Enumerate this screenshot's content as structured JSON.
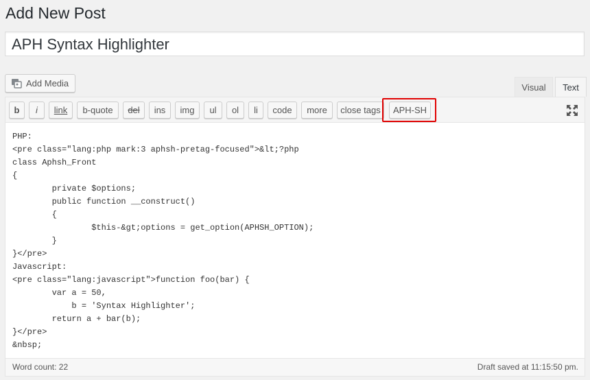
{
  "page": {
    "title": "Add New Post"
  },
  "post": {
    "title_value": "APH Syntax Highlighter"
  },
  "media": {
    "add_label": "Add Media"
  },
  "tabs": [
    {
      "label": "Visual"
    },
    {
      "label": "Text"
    }
  ],
  "toolbar": {
    "buttons": [
      {
        "label": "b"
      },
      {
        "label": "i"
      },
      {
        "label": "link"
      },
      {
        "label": "b-quote"
      },
      {
        "label": "del"
      },
      {
        "label": "ins"
      },
      {
        "label": "img"
      },
      {
        "label": "ul"
      },
      {
        "label": "ol"
      },
      {
        "label": "li"
      },
      {
        "label": "code"
      },
      {
        "label": "more"
      },
      {
        "label": "close tags"
      },
      {
        "label": "APH-SH"
      }
    ]
  },
  "content": {
    "lines": [
      "PHP:",
      "<pre class=\"lang:php mark:3 aphsh-pretag-focused\">&lt;?php",
      "class Aphsh_Front",
      "{",
      "        private $options;",
      "        public function __construct()",
      "        {",
      "                $this-&gt;options = get_option(APHSH_OPTION);",
      "        }",
      "}</pre>",
      "Javascript:",
      "<pre class=\"lang:javascript\">function foo(bar) {",
      "        var a = 50,",
      "            b = 'Syntax Highlighter';",
      "        return a + bar(b);",
      "}</pre>",
      "&nbsp;"
    ]
  },
  "status": {
    "word_count": "Word count: 22",
    "draft_saved": "Draft saved at 11:15:50 pm."
  },
  "colors": {
    "highlight_border": "#e00000",
    "background": "#f1f1f1"
  },
  "icons": {
    "media": "media-icon",
    "fullscreen": "fullscreen-icon"
  }
}
